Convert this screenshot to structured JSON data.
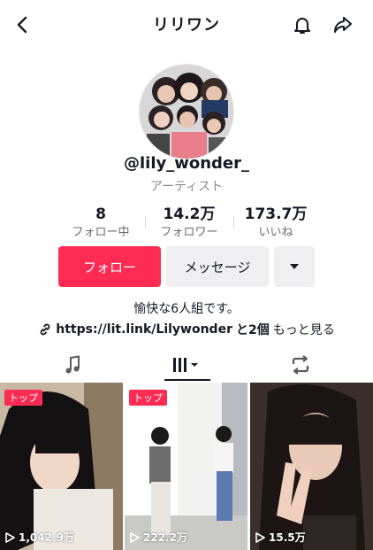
{
  "header": {
    "title": "リリワン",
    "back_icon": "chevron-left-icon",
    "bell_icon": "bell-icon",
    "share_icon": "share-arrow-icon"
  },
  "profile": {
    "handle": "@lily_wonder_",
    "category": "アーティスト",
    "avatar_icon": "group-photo-avatar"
  },
  "stats": [
    {
      "value": "8",
      "label": "フォロー中"
    },
    {
      "value": "14.2万",
      "label": "フォロワー"
    },
    {
      "value": "173.7万",
      "label": "いいね"
    }
  ],
  "actions": {
    "follow_label": "フォロー",
    "message_label": "メッセージ",
    "more_icon": "caret-down-icon"
  },
  "bio": {
    "text": "愉快な6人組です。",
    "link": "https://lit.link/Lilywonder",
    "link_suffix": "と2個",
    "more_label": "もっと見る",
    "link_icon": "link-icon"
  },
  "tabs": [
    {
      "name": "music",
      "icon": "music-note-icon"
    },
    {
      "name": "videos",
      "icon": "grid-bars-icon",
      "selected": true
    },
    {
      "name": "reposts",
      "icon": "repost-icon"
    }
  ],
  "videos": [
    {
      "badge": "トップ",
      "views": "1,042.9万"
    },
    {
      "badge": "トップ",
      "views": "222.2万"
    },
    {
      "badge": "",
      "views": "15.5万"
    }
  ],
  "colors": {
    "accent": "#fe2c55",
    "secondary_button": "#efeff1",
    "text": "#161823",
    "muted": "#8a8b91"
  }
}
